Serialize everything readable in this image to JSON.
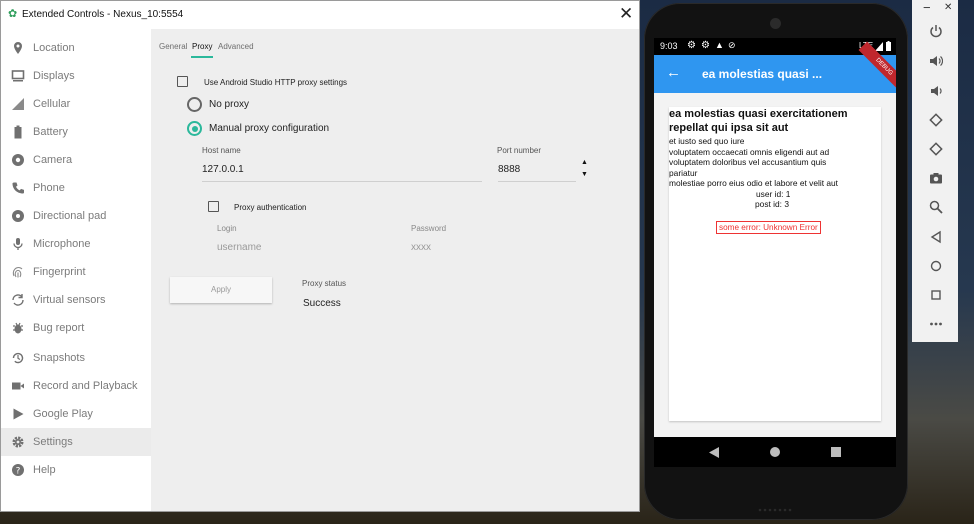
{
  "window": {
    "title": "Extended Controls - Nexus_10:5554",
    "close_glyph": "✕"
  },
  "sidebar": {
    "items": [
      {
        "label": "Location",
        "icon": "location-pin-icon"
      },
      {
        "label": "Displays",
        "icon": "display-icon"
      },
      {
        "label": "Cellular",
        "icon": "cellular-signal-icon"
      },
      {
        "label": "Battery",
        "icon": "battery-icon"
      },
      {
        "label": "Camera",
        "icon": "camera-aperture-icon"
      },
      {
        "label": "Phone",
        "icon": "phone-icon"
      },
      {
        "label": "Directional pad",
        "icon": "dpad-icon"
      },
      {
        "label": "Microphone",
        "icon": "microphone-icon"
      },
      {
        "label": "Fingerprint",
        "icon": "fingerprint-icon"
      },
      {
        "label": "Virtual sensors",
        "icon": "rotation-icon"
      },
      {
        "label": "Bug report",
        "icon": "bug-icon"
      },
      {
        "label": "Snapshots",
        "icon": "history-icon"
      },
      {
        "label": "Record and Playback",
        "icon": "videocam-icon"
      },
      {
        "label": "Google Play",
        "icon": "play-store-icon"
      },
      {
        "label": "Settings",
        "icon": "gear-icon"
      },
      {
        "label": "Help",
        "icon": "help-icon"
      }
    ],
    "selected": "Settings"
  },
  "settings": {
    "tabs": [
      "General",
      "Proxy",
      "Advanced"
    ],
    "active_tab": "Proxy",
    "use_studio_proxy_label": "Use Android Studio HTTP proxy settings",
    "no_proxy_label": "No proxy",
    "manual_proxy_label": "Manual proxy configuration",
    "host_name_label": "Host name",
    "host_name_value": "127.0.0.1",
    "port_number_label": "Port number",
    "port_number_value": "8888",
    "proxy_auth_label": "Proxy authentication",
    "login_label": "Login",
    "login_placeholder": "username",
    "password_label": "Password",
    "password_placeholder": "xxxx",
    "apply_label": "Apply",
    "proxy_status_label": "Proxy status",
    "proxy_status_value": "Success"
  },
  "phone": {
    "status_time": "9:03",
    "status_network": "LTE",
    "app_title": "ea molestias quasi ...",
    "debug_banner": "DEBUG",
    "card": {
      "title": "ea molestias quasi exercitationem repellat qui ipsa sit aut",
      "lines": [
        "et iusto sed quo iure",
        "voluptatem occaecati omnis eligendi aut ad",
        "voluptatem doloribus vel accusantium quis",
        "pariatur",
        "molestiae porro eius odio et labore et velit aut"
      ],
      "user_id": "user id: 1",
      "post_id": "post id: 3",
      "error": "some error: Unknown Error"
    }
  },
  "toolbar": {
    "minimize_glyph": "−",
    "close_glyph": "✕",
    "items": [
      "power-icon",
      "volume-up-icon",
      "volume-down-icon",
      "rotate-left-icon",
      "rotate-right-icon",
      "camera-icon",
      "zoom-icon",
      "back-icon",
      "home-icon",
      "overview-icon",
      "more-icon"
    ]
  }
}
